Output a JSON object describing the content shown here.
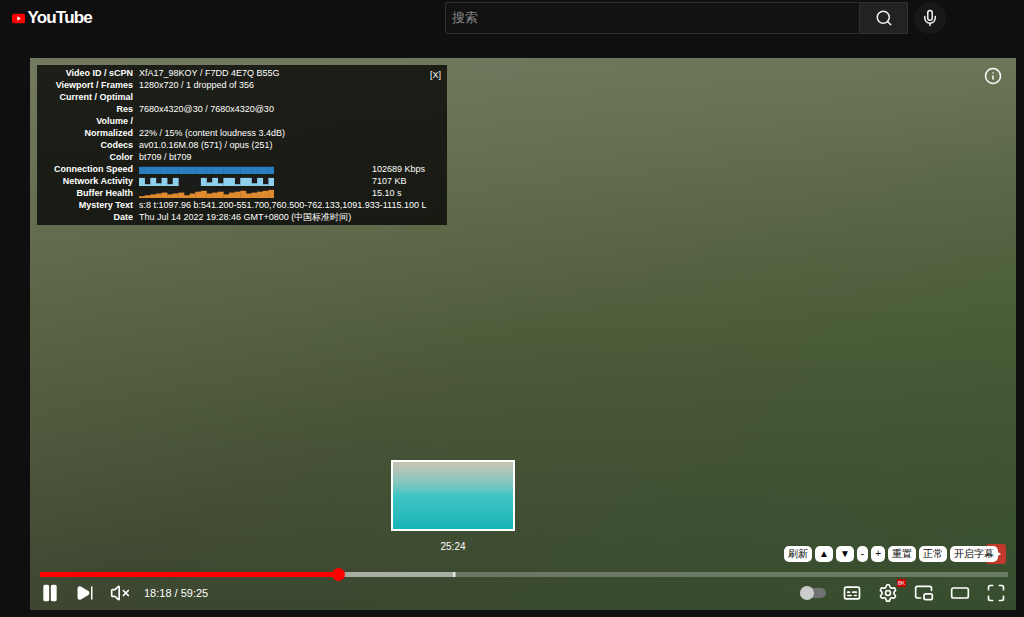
{
  "header": {
    "logo": "YouTube",
    "search": {
      "placeholder": "搜索"
    }
  },
  "stats": {
    "close": "[X]",
    "rows": [
      {
        "kind": "text",
        "label": [
          "Video ID / sCPN"
        ],
        "value": "XfA17_98KOY / F7DD 4E7Q B55G"
      },
      {
        "kind": "text",
        "label": [
          "Viewport / Frames"
        ],
        "value": "1280x720 / 1 dropped of 356"
      },
      {
        "kind": "text",
        "label": [
          "Current / Optimal",
          "Res"
        ],
        "value": "7680x4320@30 / 7680x4320@30"
      },
      {
        "kind": "text",
        "label": [
          "Volume /",
          "Normalized"
        ],
        "value": "22% / 15% (content loudness 3.4dB)"
      },
      {
        "kind": "text",
        "label": [
          "Codecs"
        ],
        "value": "av01.0.16M.08 (571) / opus (251)"
      },
      {
        "kind": "text",
        "label": [
          "Color"
        ],
        "value": "bt709 / bt709"
      },
      {
        "kind": "graph",
        "label": [
          "Connection Speed"
        ],
        "value": "102689 Kbps",
        "color": "#2a7fc0",
        "values": [
          0.8,
          0.8,
          0.8,
          0.8,
          0.8,
          0.8,
          0.8,
          0.8,
          0.8,
          0.8,
          0.8,
          0.8,
          0.8,
          0.8,
          0.8,
          0.8,
          0.8,
          0.8,
          0.8,
          0.8,
          0.8,
          0.8,
          0.8,
          0.8
        ]
      },
      {
        "kind": "graph",
        "label": [
          "Network Activity"
        ],
        "value": "7107 KB",
        "color": "#8fd0ee",
        "values": [
          0.9,
          0.2,
          0.9,
          0.3,
          0.9,
          0.2,
          0.9,
          0,
          0,
          0,
          0,
          0.9,
          0.4,
          0.9,
          0.3,
          0.9,
          0.9,
          0.2,
          0.9,
          0.9,
          0.3,
          0.9,
          0.2,
          0.9
        ]
      },
      {
        "kind": "graph",
        "label": [
          "Buffer Health"
        ],
        "value": "15.10 s",
        "color": "#e08a2e",
        "values": [
          0.2,
          0.3,
          0.4,
          0.5,
          0.6,
          0.4,
          0.5,
          0.6,
          0.3,
          0.5,
          0.7,
          0.8,
          0.5,
          0.6,
          0.7,
          0.4,
          0.6,
          0.7,
          0.8,
          0.5,
          0.6,
          0.7,
          0.8,
          0.9
        ]
      },
      {
        "kind": "text",
        "label": [
          "Mystery Text"
        ],
        "value": "s:8 t:1097.96 b:541.200-551.700,760.500-762.133,1091.933-1115.100 L"
      },
      {
        "kind": "text",
        "label": [
          "Date"
        ],
        "value": "Thu Jul 14 2022 19:28:46 GMT+0800 (中国标准时间)"
      }
    ]
  },
  "preview": {
    "time": "25:24"
  },
  "extension_buttons": [
    "刷新",
    "▲",
    "▼",
    "-",
    "+",
    "重置",
    "正常",
    "开启字幕"
  ],
  "progress": {
    "level": 0.308,
    "buffered": 0.43,
    "hover": 0.427
  },
  "controls": {
    "playing": true,
    "muted": true,
    "time": "18:18 / 59:25",
    "autoplay": {
      "on": false
    },
    "settings_badge": "8K"
  }
}
